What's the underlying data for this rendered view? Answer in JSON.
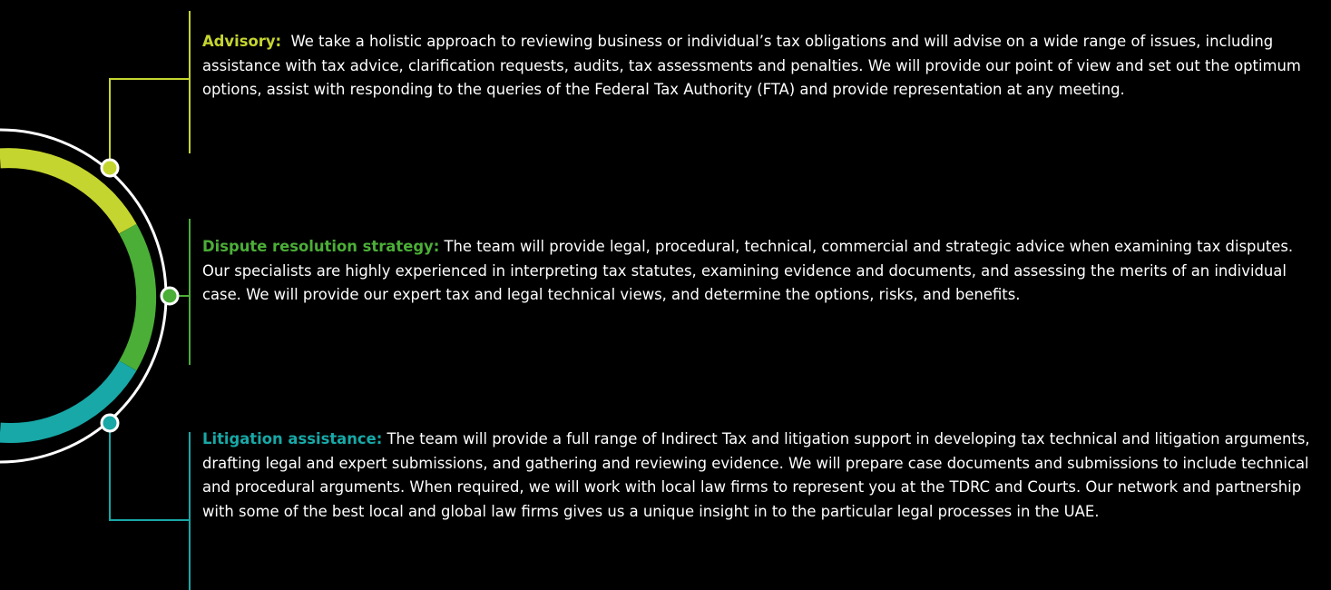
{
  "colors": {
    "background": "#000000",
    "text": "#ffffff",
    "advisory": "#c5d52f",
    "dispute": "#4bae37",
    "litigation": "#17a8a7",
    "ring": "#ffffff"
  },
  "services": [
    {
      "id": "advisory",
      "title": "Advisory:",
      "body": "We take a holistic approach to reviewing business or individual’s tax obligations and will advise on a wide range of issues, including assistance with tax advice, clarification requests, audits, tax assessments and penalties. We will provide our point of view and set out the optimum options, assist with responding to the queries of the Federal Tax Authority (FTA) and provide representation at any meeting."
    },
    {
      "id": "dispute",
      "title": "Dispute resolution strategy:",
      "body": "The team will provide legal, procedural, technical, commercial and strategic advice when examining tax disputes. Our specialists are highly experienced in interpreting tax statutes, examining evidence and documents, and assessing the merits of an individual case. We will provide our expert tax and legal technical views, and determine the options, risks, and benefits."
    },
    {
      "id": "litigation",
      "title": "Litigation assistance:",
      "body": "The team will provide a full range of Indirect Tax and litigation support in developing tax technical and litigation arguments, drafting legal and expert submissions, and gathering and reviewing evidence. We will prepare case documents and submissions to include technical and procedural arguments. When required, we will work with local law firms to represent you at the TDRC and Courts. Our network and partnership with some of the best local and global law firms gives us a unique insight in to the particular legal processes in the UAE."
    }
  ]
}
